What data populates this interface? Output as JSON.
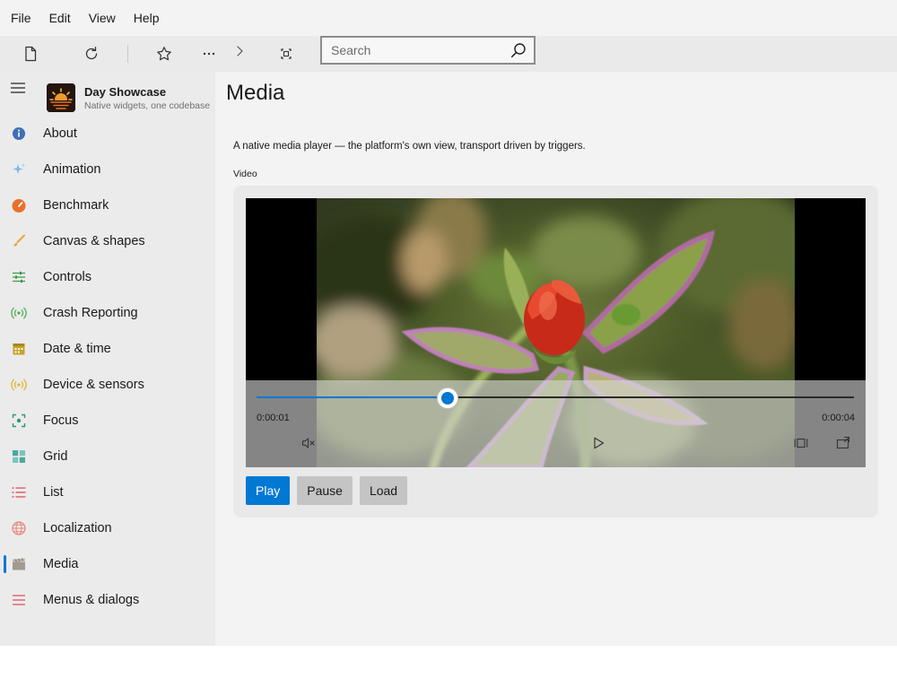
{
  "menubar": {
    "items": [
      "File",
      "Edit",
      "View",
      "Help"
    ]
  },
  "toolbar": {
    "icons": [
      "new-document-icon",
      "refresh-icon",
      "star-icon",
      "more-icon",
      "chevron-right-icon",
      "fit-screen-icon"
    ],
    "search": {
      "placeholder": "Search",
      "value": ""
    }
  },
  "sidebar": {
    "brand": {
      "title": "Day Showcase",
      "subtitle": "Native widgets, one codebase"
    },
    "selected": "Media",
    "items": [
      {
        "label": "About",
        "icon": "info-icon",
        "color": "#3f6fb5"
      },
      {
        "label": "Animation",
        "icon": "sparkle-icon",
        "color": "#7ab8e6"
      },
      {
        "label": "Benchmark",
        "icon": "speedometer-icon",
        "color": "#e8702a"
      },
      {
        "label": "Canvas & shapes",
        "icon": "brush-icon",
        "color": "#e8a53a"
      },
      {
        "label": "Controls",
        "icon": "sliders-icon",
        "color": "#3a9a4a"
      },
      {
        "label": "Crash Reporting",
        "icon": "broadcast-icon",
        "color": "#4caf50"
      },
      {
        "label": "Date & time",
        "icon": "calendar-icon",
        "color": "#c9a227"
      },
      {
        "label": "Device & sensors",
        "icon": "sensor-icon",
        "color": "#e0b32a"
      },
      {
        "label": "Focus",
        "icon": "focus-icon",
        "color": "#2e9a72"
      },
      {
        "label": "Grid",
        "icon": "grid-icon",
        "color": "#4aa8a0"
      },
      {
        "label": "List",
        "icon": "list-icon",
        "color": "#e05a6a"
      },
      {
        "label": "Localization",
        "icon": "globe-icon",
        "color": "#e58a7a"
      },
      {
        "label": "Media",
        "icon": "clapperboard-icon",
        "color": "#a29a90"
      },
      {
        "label": "Menus & dialogs",
        "icon": "menu-lines-icon",
        "color": "#e06a7a"
      }
    ]
  },
  "main": {
    "title": "Media",
    "description": "A native media player — the platform's own view, transport driven by triggers.",
    "section_label": "Video",
    "player": {
      "current_time": "0:00:01",
      "total_time": "0:00:04",
      "progress": 0.32
    },
    "buttons": {
      "play": "Play",
      "pause": "Pause",
      "load": "Load"
    }
  },
  "colors": {
    "accent": "#0078d4"
  }
}
